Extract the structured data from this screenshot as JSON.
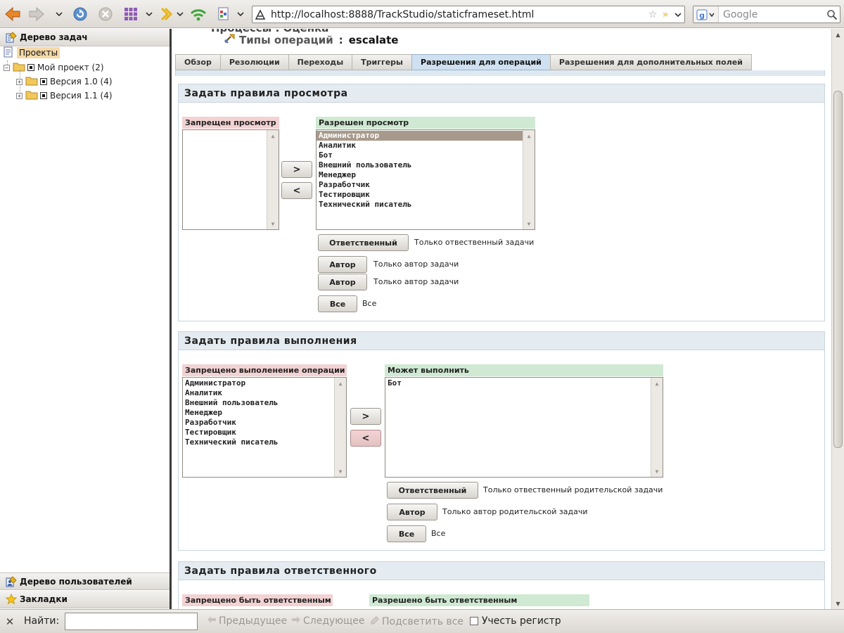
{
  "browser": {
    "url": "http://localhost:8888/TrackStudio/staticframeset.html",
    "search_placeholder": "Google"
  },
  "sidebar": {
    "tree_title": "Дерево задач",
    "root": "Проекты",
    "project": "Мой проект (2)",
    "versions": [
      "Версия 1.0 (4)",
      "Версия 1.1 (4)"
    ],
    "users_title": "Дерево пользователей",
    "bookmarks_title": "Закладки"
  },
  "header": {
    "crumb_top": "Процессы : Оценка",
    "crumb_label": "Типы операций",
    "crumb_sep": ":",
    "crumb_value": "escalate"
  },
  "tabs": [
    {
      "label": "Обзор"
    },
    {
      "label": "Резолюции"
    },
    {
      "label": "Переходы"
    },
    {
      "label": "Триггеры"
    },
    {
      "label": "Разрешения для операций",
      "active": true
    },
    {
      "label": "Разрешения для дополнительных полей"
    }
  ],
  "view_section": {
    "title": "Задать правила просмотра",
    "deny_title": "Запрещен просмотр",
    "deny_items": [],
    "allow_title": "Разрешен просмотр",
    "allow_items": [
      "Администратор",
      "Аналитик",
      "Бот",
      "Внешний пользователь",
      "Менеджер",
      "Разработчик",
      "Тестировщик",
      "Технический писатель"
    ],
    "move_right": ">",
    "move_left": "<",
    "buttons": [
      {
        "label": "Ответственный",
        "desc": "Только отвественный задачи"
      },
      {
        "label": "Автор",
        "desc": "Только автор задачи"
      },
      {
        "label": "Автор",
        "desc": "Только автор задачи"
      },
      {
        "label": "Все",
        "desc": "Все"
      }
    ]
  },
  "exec_section": {
    "title": "Задать правила выполнения",
    "deny_title": "Запрещено выполенение операции",
    "deny_items": [
      "Администратор",
      "Аналитик",
      "Внешний пользователь",
      "Менеджер",
      "Разработчик",
      "Тестировщик",
      "Технический писатель"
    ],
    "allow_title": "Может выполнить",
    "allow_items": [
      "Бот"
    ],
    "move_right": ">",
    "move_left": "<",
    "buttons": [
      {
        "label": "Ответственный",
        "desc": "Только отвественный родительской задачи"
      },
      {
        "label": "Автор",
        "desc": "Только автор родительской задачи"
      },
      {
        "label": "Все",
        "desc": "Все"
      }
    ]
  },
  "resp_section": {
    "title": "Задать правила ответственного",
    "deny_title": "Запрещено быть ответственным",
    "allow_title": "Разрешено быть ответственным"
  },
  "findbar": {
    "label": "Найти:",
    "prev": "Предыдущее",
    "next": "Следующее",
    "highlight": "Подсветить все",
    "match_case": "Учесть регистр"
  },
  "colors": {
    "deny": "#f2d2d3",
    "allow": "#cfe9d2",
    "active_tab": "#cfe0f0",
    "selected_option": "#a7998b"
  }
}
